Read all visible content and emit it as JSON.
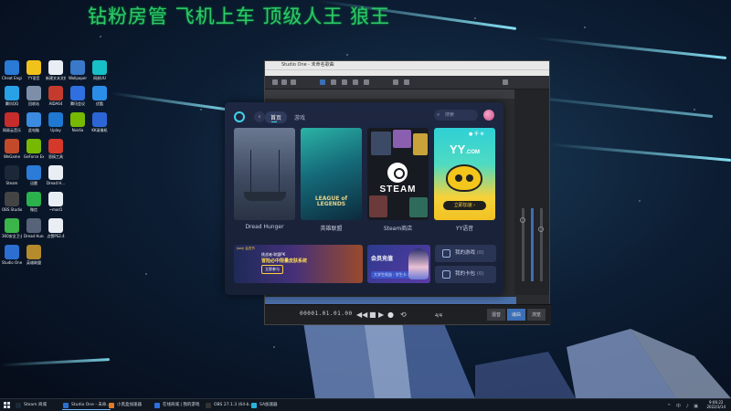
{
  "overlay": {
    "banner": "钻粉房管 飞机上车 顶级人王 狼王"
  },
  "desktop": {
    "icons": [
      {
        "label": "Cheat Engine",
        "color": "#2a7ad6"
      },
      {
        "label": "腾讯QQ",
        "color": "#29a1e6"
      },
      {
        "label": "网易云音乐",
        "color": "#c52c2c"
      },
      {
        "label": "WeGame",
        "color": "#c24a2a"
      },
      {
        "label": "Steam",
        "color": "#1b2838"
      },
      {
        "label": "OBS Studio",
        "color": "#444"
      },
      {
        "label": "360安全卫士",
        "color": "#3bb54a"
      },
      {
        "label": "Studio One",
        "color": "#2c6fd1"
      },
      {
        "label": "YY语音",
        "color": "#f2c21c"
      },
      {
        "label": "回收站",
        "color": "#7d8fa8"
      },
      {
        "label": "此电脑",
        "color": "#3b8be0"
      },
      {
        "label": "GeForce Experience",
        "color": "#76b900"
      },
      {
        "label": "迅雷",
        "color": "#2b7bd8"
      },
      {
        "label": "微信",
        "color": "#2bb24c"
      },
      {
        "label": "Dread Hunger",
        "color": "#566378"
      },
      {
        "label": "英雄联盟",
        "color": "#b58b2c"
      },
      {
        "label": "新建文本文档",
        "color": "#e9eef5"
      },
      {
        "label": "AIDA64",
        "color": "#c43b2d"
      },
      {
        "label": "Uplay",
        "color": "#1f78d1"
      },
      {
        "label": "恶搞工具",
        "color": "#d5392c"
      },
      {
        "label": "Dread H...",
        "color": "#e9eef5"
      },
      {
        "label": "~mod1",
        "color": "#e9eef5"
      },
      {
        "label": "点赞PS2.4",
        "color": "#e9eef5"
      },
      {
        "label": "Wallpaper",
        "color": "#3a78c9"
      },
      {
        "label": "腾讯会议",
        "color": "#2f6fe0"
      },
      {
        "label": "Nvidia",
        "color": "#76b900"
      },
      {
        "label": "网易UU",
        "color": "#17c0c6"
      },
      {
        "label": "优酷",
        "color": "#2a8ee8"
      },
      {
        "label": "KK录像机",
        "color": "#2c66d6"
      }
    ]
  },
  "studio_one": {
    "title": "Studio One - 未命名歌曲",
    "transport_time": "00001.01.01.00",
    "meter": "4/4",
    "tabs": [
      {
        "label": "混音",
        "on": false
      },
      {
        "label": "编曲",
        "on": true
      },
      {
        "label": "浏览",
        "on": false
      }
    ]
  },
  "launcher": {
    "nav": {
      "home": "首页",
      "games": "游戏",
      "search_placeholder": "搜索"
    },
    "cards": [
      {
        "label": "Dread Hunger"
      },
      {
        "label": "英雄联盟",
        "art_text": "LEAGUE of LEGENDS"
      },
      {
        "label": "Steam商店",
        "art_text": "STEAM"
      },
      {
        "label": "YY语音",
        "art_logo": "YY",
        "art_logo_suffix": ".COM",
        "art_top": "● 手 ⚙",
        "art_button": "立即加速 ›"
      }
    ],
    "promo": {
      "tag": "Jianji 会员节",
      "line1": "挑战者·联盟PK",
      "line2": "冒险必中限量皮肤系统",
      "line3": "立即参与"
    },
    "member": {
      "title": "会员充值",
      "sub": "大学生权益 · 学生卡 ›"
    },
    "side_buttons": [
      {
        "label": "我的游戏",
        "count": "(0)"
      },
      {
        "label": "我的卡包",
        "count": "(0)"
      }
    ]
  },
  "taskbar": {
    "tasks": [
      {
        "label": "Steam 商城",
        "color": "#1b2838",
        "active": false
      },
      {
        "label": "Studio One - 未命...",
        "color": "#2c6fd1",
        "active": true
      },
      {
        "label": "小黑盒加速器",
        "color": "#e07a2b",
        "active": false
      },
      {
        "label": "在线商城 | 我的游戏",
        "color": "#2f6fe0",
        "active": false
      },
      {
        "label": "OBS 27.1.3 (64-b...",
        "color": "#333",
        "active": false
      },
      {
        "label": "SA加速器",
        "color": "#2bb0d9",
        "active": false
      }
    ],
    "tray_icons": "^ 中 ♪ ▣",
    "time": "9:06:22",
    "date": "2022/3/14"
  }
}
